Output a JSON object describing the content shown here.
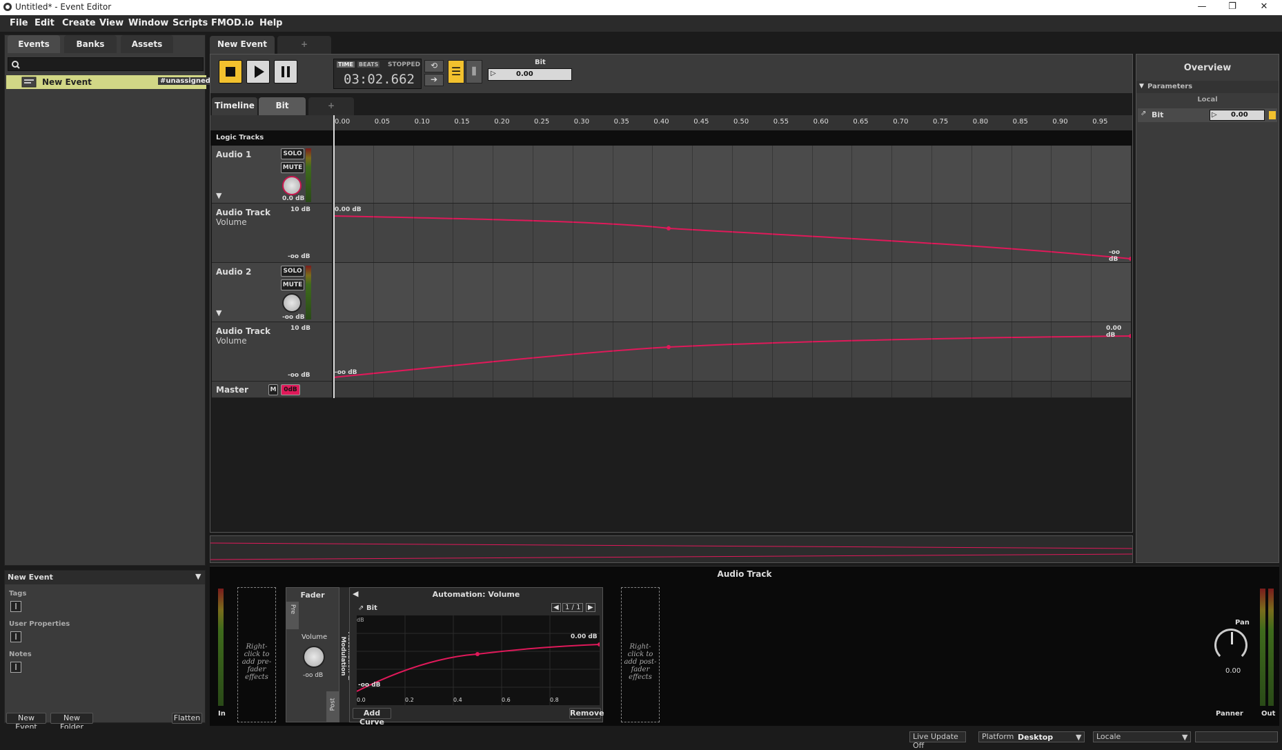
{
  "window": {
    "title": "Untitled* - Event Editor",
    "controls": [
      "—",
      "❐",
      "✕"
    ]
  },
  "menu": [
    "File",
    "Edit",
    "Create",
    "View",
    "Window",
    "Scripts",
    "FMOD.io",
    "Help"
  ],
  "browser": {
    "tabs": [
      "Events",
      "Banks",
      "Assets"
    ],
    "event_name": "New Event",
    "event_badge": "#unassigned"
  },
  "props": {
    "header": "New Event",
    "tags_label": "Tags",
    "user_props_label": "User Properties",
    "notes_label": "Notes",
    "buttons": {
      "new_event": "New Event",
      "new_folder": "New Folder",
      "flatten": "Flatten"
    }
  },
  "editor": {
    "event_tab": "New Event",
    "add_tab": "+",
    "transport": {
      "time_label": "TIME",
      "beats_label": "BEATS",
      "state": "STOPPED",
      "time": "03:02.662"
    },
    "param": {
      "name": "Bit",
      "value": "0.00"
    },
    "subtabs": [
      "Timeline",
      "Bit",
      "+"
    ],
    "ruler": [
      "0.00",
      "0.05",
      "0.10",
      "0.15",
      "0.20",
      "0.25",
      "0.30",
      "0.35",
      "0.40",
      "0.45",
      "0.50",
      "0.55",
      "0.60",
      "0.65",
      "0.70",
      "0.75",
      "0.80",
      "0.85",
      "0.90",
      "0.95"
    ],
    "logic_tracks": "Logic Tracks",
    "tracks": [
      {
        "name": "Audio 1",
        "solo": "SOLO",
        "mute": "MUTE",
        "db": "0.0 dB",
        "auto_name": "Audio Track",
        "auto_param": "Volume",
        "top": "10 dB",
        "bottom": "-oo dB",
        "start_label": "0.00 dB",
        "end_label": "-oo dB"
      },
      {
        "name": "Audio 2",
        "solo": "SOLO",
        "mute": "MUTE",
        "db": "-oo dB",
        "auto_name": "Audio Track",
        "auto_param": "Volume",
        "top": "10 dB",
        "bottom": "-oo dB",
        "start_label": "-oo dB",
        "end_label": "0.00 dB"
      }
    ],
    "master": {
      "name": "Master",
      "m": "M",
      "db": "0dB"
    }
  },
  "overview": {
    "title": "Overview",
    "section": "Parameters",
    "subsection": "Local",
    "param_name": "Bit",
    "param_value": "0.00"
  },
  "deck": {
    "title": "Audio Track",
    "pre_fx": "Right-click to add pre-fader effects",
    "post_fx": "Right-click to add post-fader effects",
    "fader": "Fader",
    "pre": "Pre",
    "post": "Post",
    "volume": "Volume",
    "volume_db": "-oo dB",
    "automod": "Automation & Modulation",
    "auto_title": "Automation: Volume",
    "auto_param": "Bit",
    "page": "1 / 1",
    "curve_top": "0.00 dB",
    "curve_bottom": "-oo dB",
    "db_unit": "dB",
    "x_ticks": [
      "0.0",
      "0.2",
      "0.4",
      "0.6",
      "0.8"
    ],
    "add_curve": "Add Curve",
    "remove": "Remove",
    "in": "In",
    "pan": "Pan",
    "pan_value": "0.00",
    "panner": "Panner",
    "out": "Out"
  },
  "status": {
    "live_update": "Live Update Off",
    "platform_label": "Platform",
    "platform": "Desktop",
    "locale_label": "Locale",
    "locale": ""
  },
  "colors": {
    "accent": "#e0195a",
    "selection": "#d2d786",
    "transport_active": "#f2c12e"
  }
}
